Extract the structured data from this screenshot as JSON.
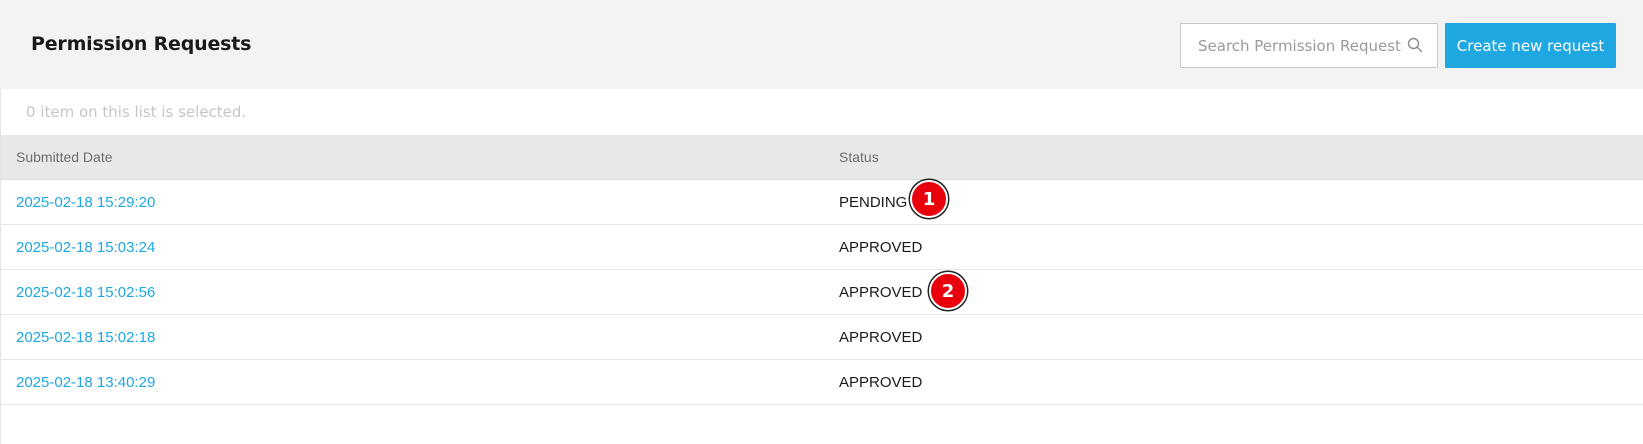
{
  "header": {
    "title": "Permission Requests",
    "search_placeholder": "Search Permission Requests",
    "search_icon": "search-icon",
    "create_button_label": "Create new request"
  },
  "selection": {
    "info": "0 item on this list is selected."
  },
  "table": {
    "columns": [
      "Submitted Date",
      "Status"
    ],
    "rows": [
      {
        "date": "2025-02-18 15:29:20",
        "status": "PENDING"
      },
      {
        "date": "2025-02-18 15:03:24",
        "status": "APPROVED"
      },
      {
        "date": "2025-02-18 15:02:56",
        "status": "APPROVED"
      },
      {
        "date": "2025-02-18 15:02:18",
        "status": "APPROVED"
      },
      {
        "date": "2025-02-18 13:40:29",
        "status": "APPROVED"
      }
    ]
  },
  "markers": [
    "1",
    "2"
  ],
  "colors": {
    "accent": "#1ea7e1",
    "marker": "#e8000c"
  }
}
